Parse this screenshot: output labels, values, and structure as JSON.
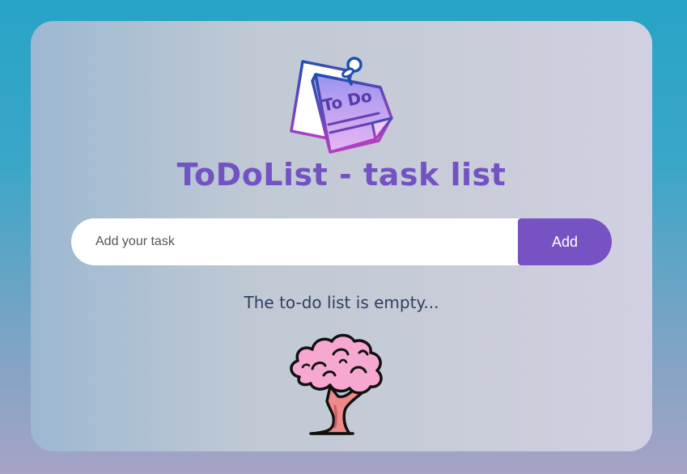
{
  "app": {
    "title": "ToDoList - task list",
    "logo_icon": "todo-note-icon",
    "logo_text": "To Do"
  },
  "form": {
    "input_placeholder": "Add your task",
    "input_value": "",
    "add_label": "Add"
  },
  "list": {
    "empty_message": "The to-do list is empty...",
    "empty_icon": "tree-icon"
  },
  "colors": {
    "accent": "#7752c2",
    "title": "#7353c2",
    "text": "#2f3e63",
    "background_top": "#27a4c6",
    "background_bottom": "#a6a3c6"
  }
}
